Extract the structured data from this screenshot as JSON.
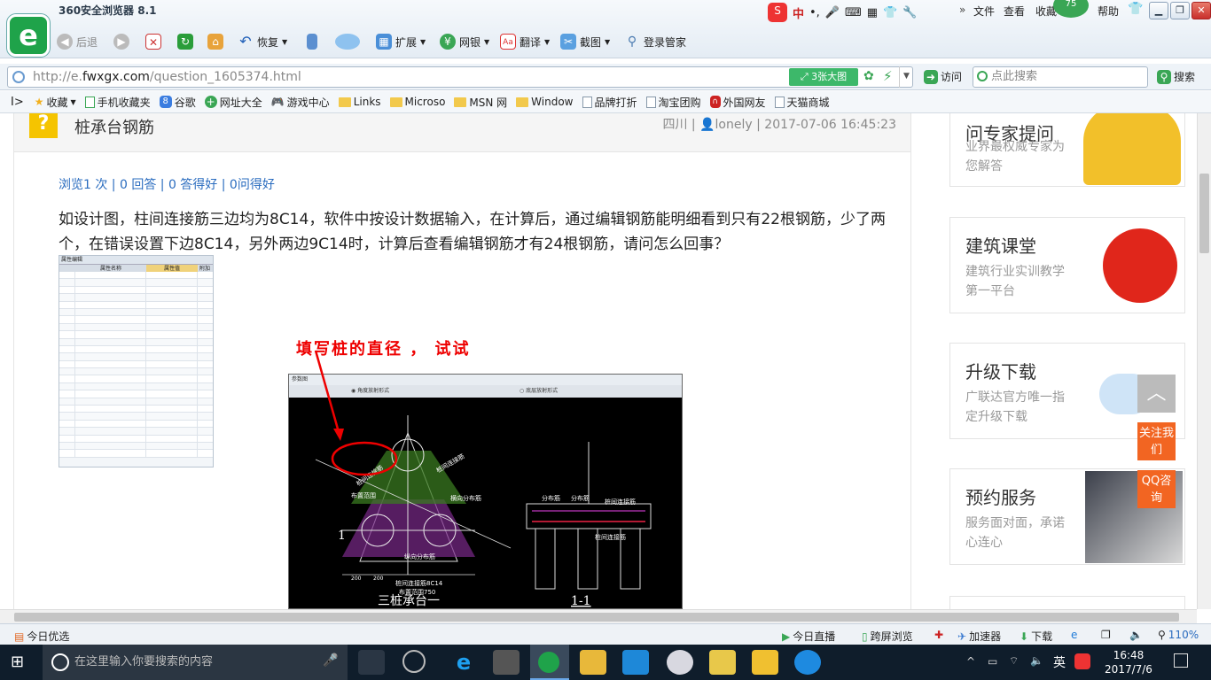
{
  "browser": {
    "title": "360安全浏览器 8.1",
    "toolbar": {
      "back": "后退",
      "restore": "恢复",
      "extend": "扩展",
      "netbank": "网银",
      "translate": "翻译",
      "screenshot": "截图",
      "login": "登录管家",
      "menu_file": "文件",
      "menu_view": "查看",
      "menu_fav": "收藏",
      "menu_help": "帮助",
      "badge": "75"
    },
    "address": {
      "url_prefix": "http://e.",
      "url_domain": "fwxgx.com",
      "url_path": "/question_1605374.html",
      "bigimg": "3张大图",
      "visit": "访问",
      "search_placeholder": "点此搜索",
      "search_btn": "搜索"
    },
    "favorites": [
      "收藏",
      "手机收藏夹",
      "谷歌",
      "网址大全",
      "游戏中心",
      "Links",
      "Microso",
      "MSN 网",
      "Window",
      "品牌打折",
      "淘宝团购",
      "外国网友",
      "天猫商城"
    ]
  },
  "question": {
    "title": "桩承台钢筋",
    "meta_region": "四川",
    "meta_user": "lonely",
    "meta_time": "2017-07-06 16:45:23",
    "stats": "浏览1 次 | 0 回答 | 0 答得好 | 0问得好",
    "body": "如设计图，柱间连接筋三边均为8C14，软件中按设计数据输入，在计算后，通过编辑钢筋能明细看到只有22根钢筋，少了两个，在错误设置下边8C14，另外两边9C14时，计算后查看编辑钢筋才有24根钢筋，请问怎么回事？"
  },
  "figure": {
    "annotation": "填写桩的直径 ， 试试",
    "table_tab": "属性编辑",
    "table_headers": [
      "属性名称",
      "属性值",
      "附加"
    ],
    "cad_title": "三桩承台一",
    "cad_section": "1-1",
    "cad_tab": "参数图",
    "cad_option1": "角度放射形式",
    "cad_option2": "底层放射形式",
    "cad_labels": [
      "桩间连接筋",
      "布置范围",
      "横向分布筋",
      "纵向分布筋",
      "分布筋",
      "桩间连接筋8C14",
      "布置范围750",
      "1",
      "200",
      "200"
    ]
  },
  "sidebar": {
    "cards": [
      {
        "title": "问专家提问",
        "sub": "业界最权威专家为您解答"
      },
      {
        "title": "建筑课堂",
        "sub": "建筑行业实训教学第一平台"
      },
      {
        "title": "升级下载",
        "sub": "广联达官方唯一指定升级下载"
      },
      {
        "title": "预约服务",
        "sub": "服务面对面，承诺心连心"
      }
    ],
    "float_follow": "关注我们",
    "float_qq": "QQ咨询"
  },
  "statusbar": {
    "left": "今日优选",
    "live": "今日直播",
    "cross": "跨屏浏览",
    "accel": "加速器",
    "download": "下载",
    "zoom": "110%"
  },
  "taskbar": {
    "search_placeholder": "在这里输入你要搜索的内容",
    "ime": "英",
    "time": "16:48",
    "date": "2017/7/6"
  },
  "colors": {
    "link": "#2a6cbf",
    "accent_orange": "#f26522",
    "brand_green": "#1fa34a",
    "annotation_red": "#e00000"
  }
}
